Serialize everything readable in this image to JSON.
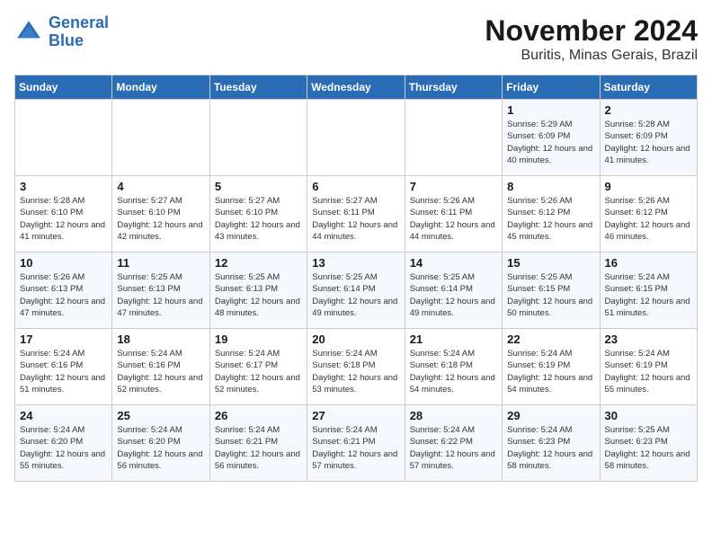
{
  "logo": {
    "line1": "General",
    "line2": "Blue"
  },
  "title": "November 2024",
  "subtitle": "Buritis, Minas Gerais, Brazil",
  "days_of_week": [
    "Sunday",
    "Monday",
    "Tuesday",
    "Wednesday",
    "Thursday",
    "Friday",
    "Saturday"
  ],
  "weeks": [
    [
      {
        "day": "",
        "info": ""
      },
      {
        "day": "",
        "info": ""
      },
      {
        "day": "",
        "info": ""
      },
      {
        "day": "",
        "info": ""
      },
      {
        "day": "",
        "info": ""
      },
      {
        "day": "1",
        "info": "Sunrise: 5:29 AM\nSunset: 6:09 PM\nDaylight: 12 hours and 40 minutes."
      },
      {
        "day": "2",
        "info": "Sunrise: 5:28 AM\nSunset: 6:09 PM\nDaylight: 12 hours and 41 minutes."
      }
    ],
    [
      {
        "day": "3",
        "info": "Sunrise: 5:28 AM\nSunset: 6:10 PM\nDaylight: 12 hours and 41 minutes."
      },
      {
        "day": "4",
        "info": "Sunrise: 5:27 AM\nSunset: 6:10 PM\nDaylight: 12 hours and 42 minutes."
      },
      {
        "day": "5",
        "info": "Sunrise: 5:27 AM\nSunset: 6:10 PM\nDaylight: 12 hours and 43 minutes."
      },
      {
        "day": "6",
        "info": "Sunrise: 5:27 AM\nSunset: 6:11 PM\nDaylight: 12 hours and 44 minutes."
      },
      {
        "day": "7",
        "info": "Sunrise: 5:26 AM\nSunset: 6:11 PM\nDaylight: 12 hours and 44 minutes."
      },
      {
        "day": "8",
        "info": "Sunrise: 5:26 AM\nSunset: 6:12 PM\nDaylight: 12 hours and 45 minutes."
      },
      {
        "day": "9",
        "info": "Sunrise: 5:26 AM\nSunset: 6:12 PM\nDaylight: 12 hours and 46 minutes."
      }
    ],
    [
      {
        "day": "10",
        "info": "Sunrise: 5:26 AM\nSunset: 6:13 PM\nDaylight: 12 hours and 47 minutes."
      },
      {
        "day": "11",
        "info": "Sunrise: 5:25 AM\nSunset: 6:13 PM\nDaylight: 12 hours and 47 minutes."
      },
      {
        "day": "12",
        "info": "Sunrise: 5:25 AM\nSunset: 6:13 PM\nDaylight: 12 hours and 48 minutes."
      },
      {
        "day": "13",
        "info": "Sunrise: 5:25 AM\nSunset: 6:14 PM\nDaylight: 12 hours and 49 minutes."
      },
      {
        "day": "14",
        "info": "Sunrise: 5:25 AM\nSunset: 6:14 PM\nDaylight: 12 hours and 49 minutes."
      },
      {
        "day": "15",
        "info": "Sunrise: 5:25 AM\nSunset: 6:15 PM\nDaylight: 12 hours and 50 minutes."
      },
      {
        "day": "16",
        "info": "Sunrise: 5:24 AM\nSunset: 6:15 PM\nDaylight: 12 hours and 51 minutes."
      }
    ],
    [
      {
        "day": "17",
        "info": "Sunrise: 5:24 AM\nSunset: 6:16 PM\nDaylight: 12 hours and 51 minutes."
      },
      {
        "day": "18",
        "info": "Sunrise: 5:24 AM\nSunset: 6:16 PM\nDaylight: 12 hours and 52 minutes."
      },
      {
        "day": "19",
        "info": "Sunrise: 5:24 AM\nSunset: 6:17 PM\nDaylight: 12 hours and 52 minutes."
      },
      {
        "day": "20",
        "info": "Sunrise: 5:24 AM\nSunset: 6:18 PM\nDaylight: 12 hours and 53 minutes."
      },
      {
        "day": "21",
        "info": "Sunrise: 5:24 AM\nSunset: 6:18 PM\nDaylight: 12 hours and 54 minutes."
      },
      {
        "day": "22",
        "info": "Sunrise: 5:24 AM\nSunset: 6:19 PM\nDaylight: 12 hours and 54 minutes."
      },
      {
        "day": "23",
        "info": "Sunrise: 5:24 AM\nSunset: 6:19 PM\nDaylight: 12 hours and 55 minutes."
      }
    ],
    [
      {
        "day": "24",
        "info": "Sunrise: 5:24 AM\nSunset: 6:20 PM\nDaylight: 12 hours and 55 minutes."
      },
      {
        "day": "25",
        "info": "Sunrise: 5:24 AM\nSunset: 6:20 PM\nDaylight: 12 hours and 56 minutes."
      },
      {
        "day": "26",
        "info": "Sunrise: 5:24 AM\nSunset: 6:21 PM\nDaylight: 12 hours and 56 minutes."
      },
      {
        "day": "27",
        "info": "Sunrise: 5:24 AM\nSunset: 6:21 PM\nDaylight: 12 hours and 57 minutes."
      },
      {
        "day": "28",
        "info": "Sunrise: 5:24 AM\nSunset: 6:22 PM\nDaylight: 12 hours and 57 minutes."
      },
      {
        "day": "29",
        "info": "Sunrise: 5:24 AM\nSunset: 6:23 PM\nDaylight: 12 hours and 58 minutes."
      },
      {
        "day": "30",
        "info": "Sunrise: 5:25 AM\nSunset: 6:23 PM\nDaylight: 12 hours and 58 minutes."
      }
    ]
  ]
}
